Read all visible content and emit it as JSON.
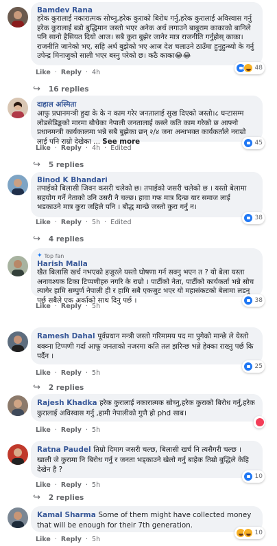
{
  "comments": [
    {
      "author": "Bamdev Rana",
      "text": "हरेक कुरालाई नकारात्मक सोच्नु,हरेक कुराको बिरोध गर्नु,हरेक कुरालाई अविस्वास गर्नु हरेक कुरालाई बडो बुद्धिमान जस्तो भएर अनेक अर्थ लगाउने बाबुराम काकाको बानिले पनि सानो हैसियत दियो आज। सबै कुरा बुझेर जानेर मात्र राजनीति गर्नुहोस् काका। राजनीति जानेको भए, सहि अर्थ बुझेको भए आज देश चलाउने ठाउँमा हुनुहुन्थ्यो के गर्नु उपेन्द्र मिनाजुको साली भएर बस्नु परेको छ। कठै काका😂😂",
      "timestamp": "4h",
      "edited": "",
      "reaction_count": "48",
      "replies": "16 replies",
      "top_fan": ""
    },
    {
      "author": "दाहाल अस्मिता",
      "text": "आफु प्रधानमन्त्री हुदा के के न काम गरेर जनतालाई सुख दिएको जस्तो।८ घन्टासम्म लोडसेडिङ्कको मारमा बौचेका नेपाली जनतालाई कस्ले कति काम गरेको छ आफ्नो प्रधानमन्त्री कार्यकालमा भन्ने सबै बुझेका छन् २/४ जना अन्धभक्त कार्यकर्ताले नराम्रो लाई पनि राम्रो देखेका ...",
      "see_more": "See more",
      "timestamp": "4h",
      "edited": "Edited",
      "reaction_count": "45",
      "replies": "5 replies",
      "top_fan": ""
    },
    {
      "author": "Binod K Bhandari",
      "text": "तपाईको बिलासी जिवन कसरी चलेको छ। तपाईको जसरी चलेको छ । यस्तो बेलामा सहयोग गर्ने नेताको उनि उसरी नै चल्छ। हावा गफ मात्र दिन्छ यार समाज लाई भडकाउने मात्र कुरा जहिले पनि । बौद्ध मान्छे जस्तो कुरा गर्नु न।",
      "timestamp": "5h",
      "edited": "Edited",
      "reaction_count": "38",
      "replies": "4 replies",
      "top_fan": ""
    },
    {
      "author": "Harish Malla",
      "text": "खैत बिलासि खर्च नभएको हजुरले यस्तो घोषणा गर्न सक्नु भएन त ? यो बेला यस्ता अनावश्यक टिका टिप्पणीहरु नगरि के राम्रो । पार्टीको नेता, पार्टीको कार्यकर्ता भन्ने सोच त्यागेर हामि सम्पुर्ण नेपाली ही र हामि सबै एकजुट भएर यो महासंकटको बेलामा लडनु पर्छ सबैले एक अर्काको साथ दिनु पर्छ ।",
      "timestamp": "5h",
      "edited": "",
      "reaction_count": "38",
      "replies": "",
      "top_fan": "Top fan"
    },
    {
      "author": "Ramesh Dahal",
      "text": "पूर्वप्रधान मन्त्री जस्तो गरिमामय पद मा पुगेको मान्छे ले येस्तो बक्व्ना टिप्पणी गर्दा आफू जनताको नजरमा कति तल झरिन्छ भन्ने हेक्का राख्नु पर्छ कि पर्दैन ।",
      "timestamp": "5h",
      "edited": "",
      "reaction_count": "25",
      "replies": "2 replies",
      "top_fan": ""
    },
    {
      "author": "Rajesh Khadka",
      "text": "हरेक कुरालाई नकारात्मक सोच्नु,हरेक कुराको बिरोध गर्नु,हरेक कुरालाई अविस्वास गर्नु ,हामी नेपालीको गुणै हो phd साब।",
      "timestamp": "5h",
      "edited": "",
      "reaction_count": "",
      "replies": "",
      "top_fan": ""
    },
    {
      "author": "Ratna Paudel",
      "text": "तिम्रो दिमाग जसरी चल्छ, बिलासी खर्च नि त्यसैगरी चल्छ । खाली जे कुरामा नि बिरोध गर्नु र जनता भड्काउने खेलो गर्नु बाहेक तिम्रो बुद्धिले केहि देखेन है ?",
      "timestamp": "5h",
      "edited": "",
      "reaction_count": "10",
      "replies": "2 replies",
      "top_fan": ""
    },
    {
      "author": "Kamal Sharma",
      "text": "Some of them might have collected money that will be enough for their 7th generation.",
      "timestamp": "5h",
      "edited": "",
      "reaction_count": "10",
      "replies": "",
      "top_fan": ""
    }
  ],
  "actions": {
    "like": "Like",
    "reply": "Reply",
    "dot": "·"
  },
  "colors": {
    "author": "#385898",
    "bubble": "#f0f2f5",
    "meta": "#65676b",
    "like": "#2078f4",
    "haha": "#f7b125"
  },
  "icons": {
    "reply_arrow": "reply-arrow-icon",
    "top_fan": "top-fan-icon",
    "like": "like-reaction-icon",
    "haha": "haha-reaction-icon"
  }
}
